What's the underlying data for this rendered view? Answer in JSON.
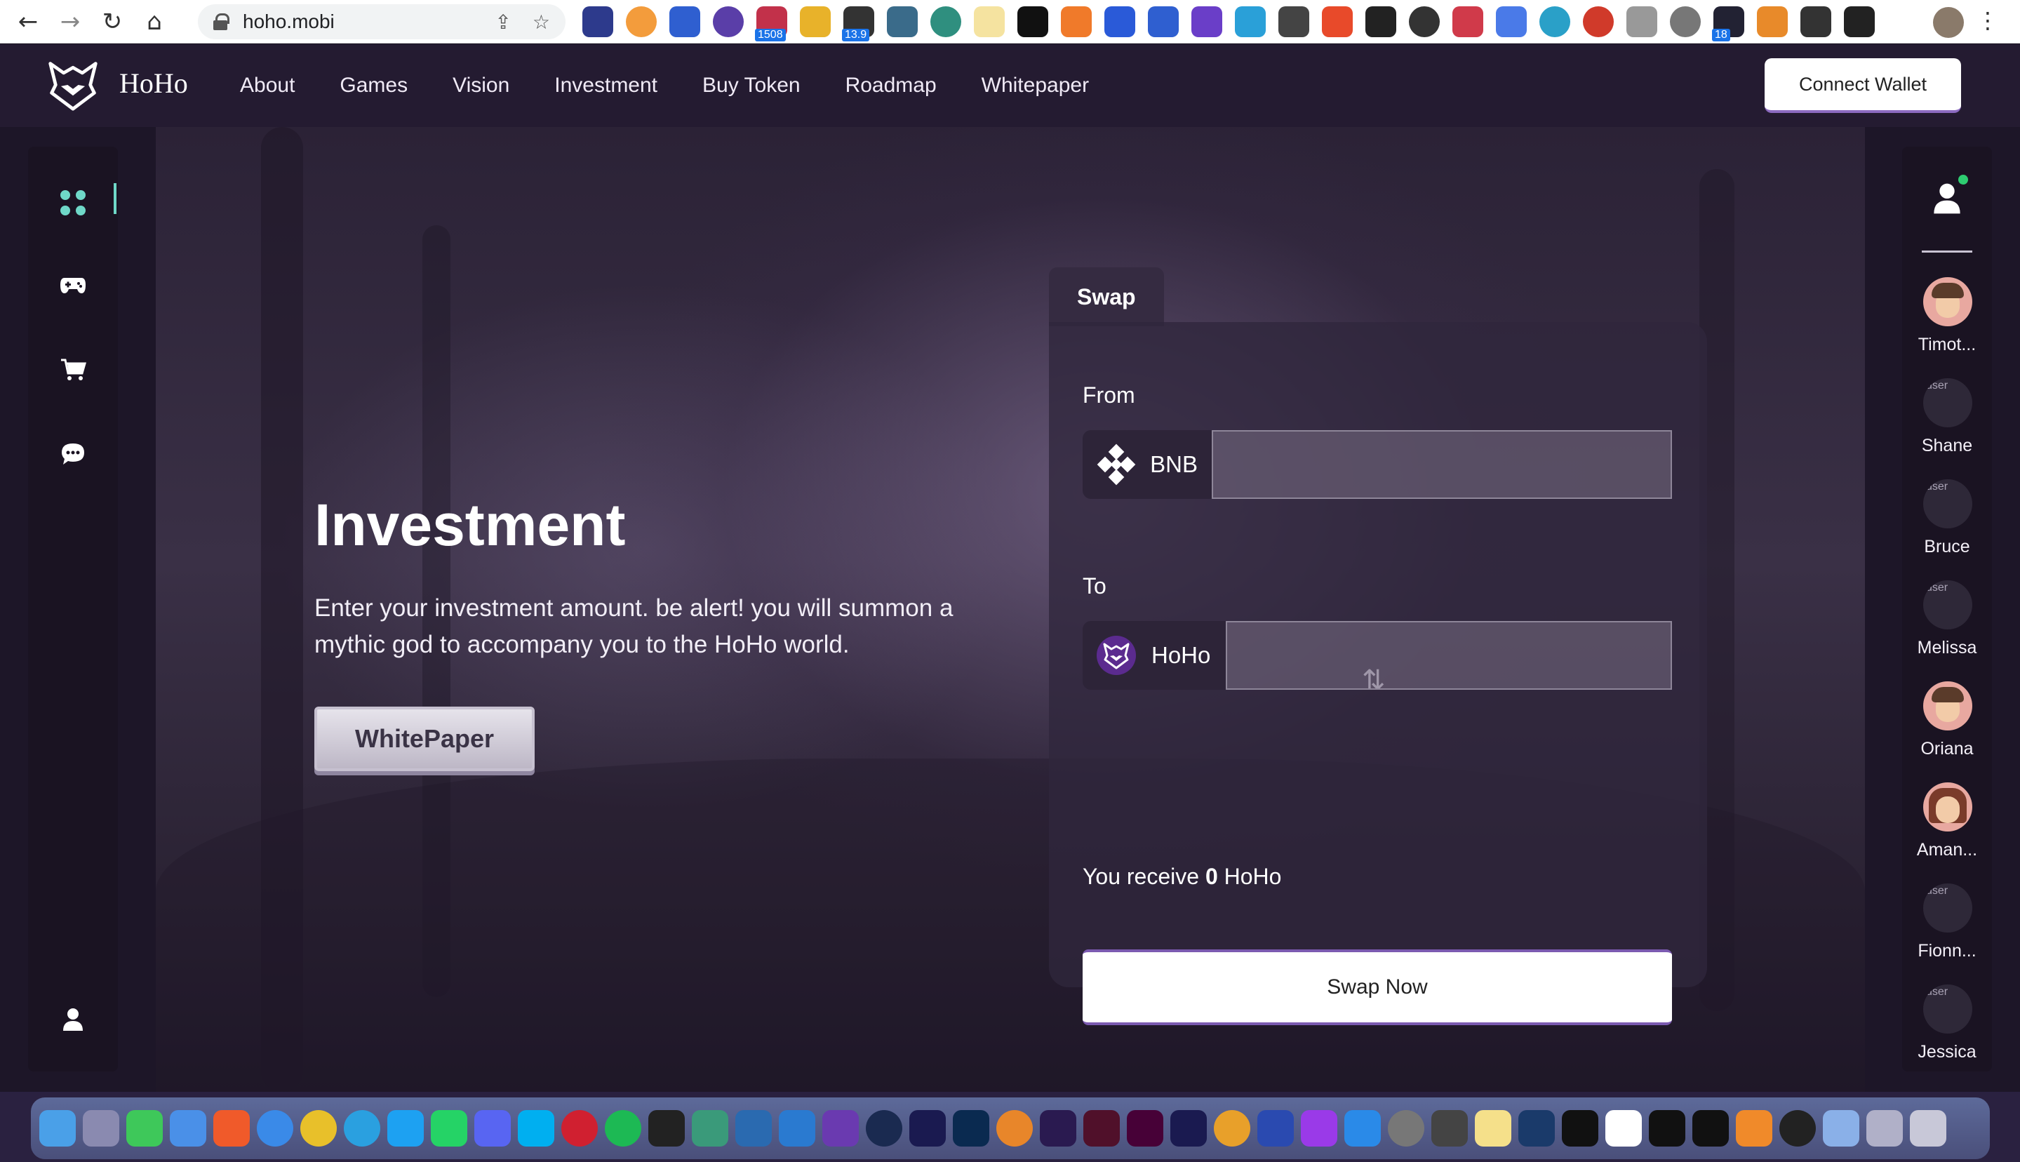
{
  "browser": {
    "url": "hoho.mobi",
    "back_icon": "arrow-left-icon",
    "forward_icon": "arrow-right-icon",
    "reload_icon": "reload-icon",
    "home_icon": "home-icon",
    "ext_badges": [
      "1508",
      "13.9",
      "18"
    ]
  },
  "header": {
    "brand": "HoHo",
    "nav": [
      "About",
      "Games",
      "Vision",
      "Investment",
      "Buy Token",
      "Roadmap",
      "Whitepaper"
    ],
    "connect_label": "Connect Wallet"
  },
  "hero": {
    "title": "Investment",
    "description": "Enter your investment amount. be alert! you will summon a mythic god to accompany you to the HoHo world.",
    "whitepaper_label": "WhitePaper"
  },
  "swap": {
    "tab_label": "Swap",
    "from_label": "From",
    "from_token": "BNB",
    "from_value": "",
    "to_label": "To",
    "to_token": "HoHo",
    "to_value": "",
    "receive_prefix": "You receive",
    "receive_amount": "0",
    "receive_token": "HoHo",
    "swap_button": "Swap Now"
  },
  "users": [
    {
      "name": "Timot...",
      "avatar": "face"
    },
    {
      "name": "Shane",
      "avatar": "placeholder"
    },
    {
      "name": "Bruce",
      "avatar": "placeholder"
    },
    {
      "name": "Melissa",
      "avatar": "placeholder"
    },
    {
      "name": "Oriana",
      "avatar": "face"
    },
    {
      "name": "Aman...",
      "avatar": "face-long"
    },
    {
      "name": "Fionn...",
      "avatar": "placeholder"
    },
    {
      "name": "Jessica",
      "avatar": "placeholder"
    }
  ],
  "avatar_placeholder_text": "user",
  "colors": {
    "accent_teal": "#6fd8c8",
    "header_bg": "#241b31",
    "online": "#2ecc71",
    "swap_border": "#7b5ab0"
  }
}
